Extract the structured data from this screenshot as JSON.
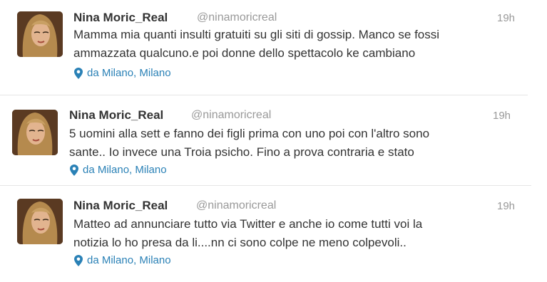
{
  "colors": {
    "link": "#2a81b6",
    "muted": "#999999",
    "text": "#333333"
  },
  "tweets": [
    {
      "name": "Nina Moric_Real",
      "handle": "@ninamoricreal",
      "time": "19h",
      "lines": [
        "Mamma mia quanti insulti gratuiti su gli siti di gossip. Manco se fossi",
        "ammazzata qualcuno.e poi donne dello spettacolo ke cambiano"
      ],
      "location": "da Milano, Milano",
      "location_icon": "map-pin-icon"
    },
    {
      "name": "Nina Moric_Real",
      "handle": "@ninamoricreal",
      "time": "19h",
      "lines": [
        "5 uomini alla sett e fanno dei figli prima con uno poi con l'altro sono",
        "sante.. Io invece una Troia psicho. Fino a prova contraria e stato"
      ],
      "location": "da Milano, Milano",
      "location_icon": "map-pin-icon"
    },
    {
      "name": "Nina Moric_Real",
      "handle": "@ninamoricreal",
      "time": "19h",
      "lines": [
        "Matteo ad annunciare tutto via Twitter e anche io come tutti voi la",
        "notizia lo ho presa da li....nn ci sono colpe ne meno colpevoli.."
      ],
      "location": "da Milano, Milano",
      "location_icon": "map-pin-icon"
    }
  ]
}
